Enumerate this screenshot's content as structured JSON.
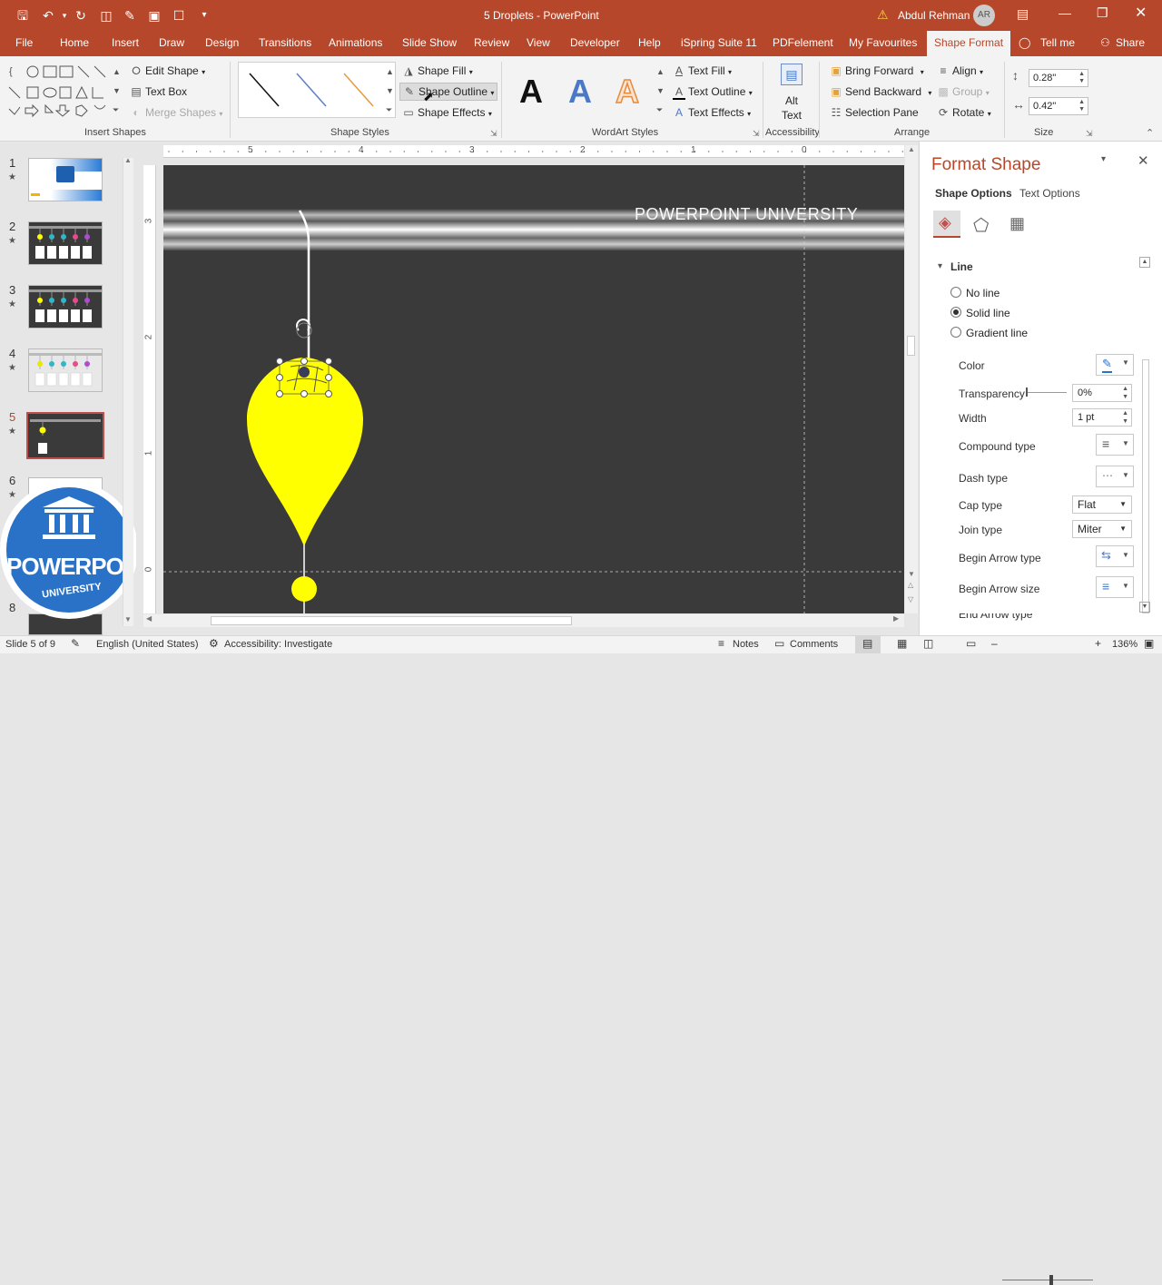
{
  "titlebar": {
    "title": "5 Droplets  -  PowerPoint",
    "user_name": "Abdul Rehman",
    "user_initials": "AR",
    "accent": "#b7472a"
  },
  "tabs": [
    "File",
    "Home",
    "Insert",
    "Draw",
    "Design",
    "Transitions",
    "Animations",
    "Slide Show",
    "Review",
    "View",
    "Developer",
    "Help",
    "iSpring Suite 11",
    "PDFelement",
    "My Favourites",
    "Shape Format",
    "Tell me",
    "Share"
  ],
  "ribbon": {
    "insert_shapes": {
      "edit_shape": "Edit Shape",
      "text_box": "Text Box",
      "merge_shapes": "Merge Shapes",
      "label": "Insert Shapes"
    },
    "shape_styles": {
      "fill": "Shape Fill",
      "outline": "Shape Outline",
      "effects": "Shape Effects",
      "label": "Shape Styles"
    },
    "wordart": {
      "text_fill": "Text Fill",
      "text_outline": "Text Outline",
      "text_effects": "Text Effects",
      "label": "WordArt Styles",
      "sample": "A"
    },
    "accessibility": {
      "alt_text_1": "Alt",
      "alt_text_2": "Text",
      "label": "Accessibility"
    },
    "arrange": {
      "bring_forward": "Bring Forward",
      "send_backward": "Send Backward",
      "selection_pane": "Selection Pane",
      "align": "Align",
      "group": "Group",
      "rotate": "Rotate",
      "label": "Arrange"
    },
    "size": {
      "height": "0.28\"",
      "width": "0.42\"",
      "label": "Size"
    }
  },
  "ruler": {
    "h_ticks": [
      "5",
      "4",
      "3",
      "2",
      "1",
      "0"
    ],
    "v_ticks": [
      "3",
      "2",
      "1",
      "0"
    ]
  },
  "thumbnails": [
    {
      "num": "1",
      "star": "★"
    },
    {
      "num": "2",
      "star": "★"
    },
    {
      "num": "3",
      "star": "★"
    },
    {
      "num": "4",
      "star": "★"
    },
    {
      "num": "5",
      "star": "★"
    },
    {
      "num": "6",
      "star": "★"
    },
    {
      "num": "8",
      "star": ""
    }
  ],
  "slide": {
    "banner_text": "POWERPOINT UNIVERSITY",
    "droplet_color": "#ffff00",
    "bg_color": "#3a3a3a"
  },
  "logo": {
    "line1": "POWERPOINT",
    "line2": "UNIVERSITY"
  },
  "format_pane": {
    "title": "Format Shape",
    "tab_shape": "Shape Options",
    "tab_text": "Text Options",
    "section": "Line",
    "no_line": "No line",
    "solid_line": "Solid line",
    "gradient_line": "Gradient line",
    "color": "Color",
    "transparency": "Transparency",
    "transparency_value": "0%",
    "width": "Width",
    "width_value": "1 pt",
    "compound_type": "Compound type",
    "dash_type": "Dash type",
    "cap_type": "Cap type",
    "cap_value": "Flat",
    "join_type": "Join type",
    "join_value": "Miter",
    "begin_arrow_type": "Begin Arrow type",
    "begin_arrow_size": "Begin Arrow size",
    "end_arrow_partial": "End Arrow type"
  },
  "statusbar": {
    "slide_info": "Slide 5 of 9",
    "language": "English (United States)",
    "accessibility": "Accessibility: Investigate",
    "notes": "Notes",
    "comments": "Comments",
    "zoom": "136%"
  }
}
